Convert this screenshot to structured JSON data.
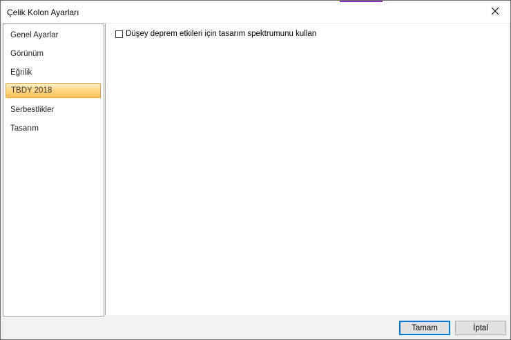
{
  "window": {
    "title": "Çelik Kolon Ayarları",
    "close_icon": "close-icon"
  },
  "sidebar": {
    "items": [
      {
        "label": "Genel Ayarlar",
        "selected": false
      },
      {
        "label": "Görünüm",
        "selected": false
      },
      {
        "label": "Eğrilik",
        "selected": false
      },
      {
        "label": "TBDY 2018",
        "selected": true
      },
      {
        "label": "Serbestlikler",
        "selected": false
      },
      {
        "label": "Tasarım",
        "selected": false
      }
    ]
  },
  "content": {
    "checkbox_label": "Düşey deprem etkileri için tasarım spektrumunu kullan",
    "checkbox_checked": false
  },
  "footer": {
    "ok_label": "Tamam",
    "cancel_label": "İptal"
  },
  "colors": {
    "selected_start": "#fff0c8",
    "selected_end": "#ffbe55",
    "accent": "#0078d7"
  }
}
